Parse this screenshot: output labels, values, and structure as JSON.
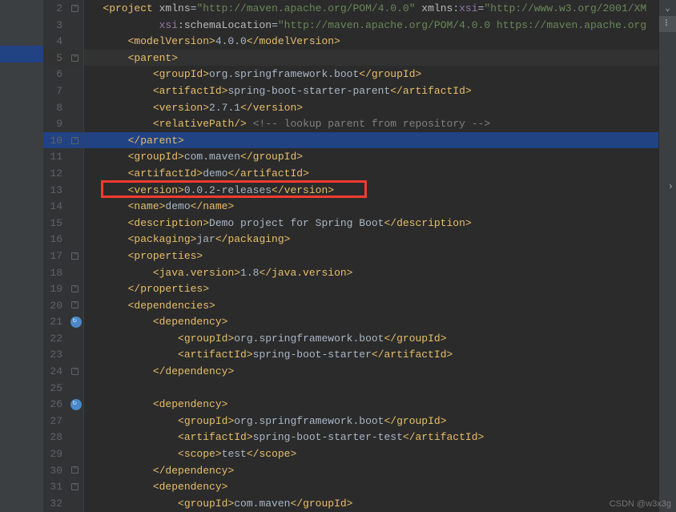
{
  "lineNumbers": [
    "2",
    "3",
    "4",
    "5",
    "6",
    "7",
    "8",
    "9",
    "10",
    "11",
    "12",
    "13",
    "14",
    "15",
    "16",
    "17",
    "18",
    "19",
    "20",
    "21",
    "22",
    "23",
    "24",
    "25",
    "26",
    "27",
    "28",
    "29",
    "30",
    "31",
    "32"
  ],
  "code": {
    "l2": {
      "indent": "   ",
      "parts": [
        {
          "t": "<project ",
          "c": "tag"
        },
        {
          "t": "xmlns",
          "c": "attr-name"
        },
        {
          "t": "=",
          "c": "text-val"
        },
        {
          "t": "\"http://maven.apache.org/POM/4.0.0\"",
          "c": "attr-val"
        },
        {
          "t": " xmlns",
          "c": "attr-name"
        },
        {
          "t": ":",
          "c": "text-val"
        },
        {
          "t": "xsi",
          "c": "ns"
        },
        {
          "t": "=",
          "c": "text-val"
        },
        {
          "t": "\"http://www.w3.org/2001/XM",
          "c": "attr-val"
        }
      ]
    },
    "l3": {
      "indent": "            ",
      "parts": [
        {
          "t": "xsi",
          "c": "ns"
        },
        {
          "t": ":schemaLocation",
          "c": "attr-name"
        },
        {
          "t": "=",
          "c": "text-val"
        },
        {
          "t": "\"http://maven.apache.org/POM/4.0.0 https://maven.apache.org",
          "c": "attr-val"
        }
      ]
    },
    "l4": {
      "indent": "       ",
      "parts": [
        {
          "t": "<modelVersion>",
          "c": "tag"
        },
        {
          "t": "4.0.0",
          "c": "text-val"
        },
        {
          "t": "</modelVersion>",
          "c": "tag"
        }
      ]
    },
    "l5": {
      "indent": "       ",
      "parts": [
        {
          "t": "<parent>",
          "c": "tag"
        }
      ]
    },
    "l6": {
      "indent": "           ",
      "parts": [
        {
          "t": "<groupId>",
          "c": "tag"
        },
        {
          "t": "org.springframework.boot",
          "c": "text-val"
        },
        {
          "t": "</groupId>",
          "c": "tag"
        }
      ]
    },
    "l7": {
      "indent": "           ",
      "parts": [
        {
          "t": "<artifactId>",
          "c": "tag"
        },
        {
          "t": "spring-boot-starter-parent",
          "c": "text-val"
        },
        {
          "t": "</artifactId>",
          "c": "tag"
        }
      ]
    },
    "l8": {
      "indent": "           ",
      "parts": [
        {
          "t": "<version>",
          "c": "tag"
        },
        {
          "t": "2.7.1",
          "c": "text-val"
        },
        {
          "t": "</version>",
          "c": "tag"
        }
      ]
    },
    "l9": {
      "indent": "           ",
      "parts": [
        {
          "t": "<relativePath/>",
          "c": "tag"
        },
        {
          "t": " ",
          "c": "text-val"
        },
        {
          "t": "<!-- lookup parent from repository -->",
          "c": "comment"
        }
      ]
    },
    "l10": {
      "indent": "       ",
      "parts": [
        {
          "t": "</parent>",
          "c": "tag"
        }
      ]
    },
    "l11": {
      "indent": "       ",
      "parts": [
        {
          "t": "<groupId>",
          "c": "tag"
        },
        {
          "t": "com.maven",
          "c": "text-val"
        },
        {
          "t": "</groupId>",
          "c": "tag"
        }
      ]
    },
    "l12": {
      "indent": "       ",
      "parts": [
        {
          "t": "<artifactId>",
          "c": "tag"
        },
        {
          "t": "demo",
          "c": "text-val"
        },
        {
          "t": "</artifactId>",
          "c": "tag"
        }
      ]
    },
    "l13": {
      "indent": "       ",
      "parts": [
        {
          "t": "<version>",
          "c": "tag"
        },
        {
          "t": "0.0.2-releases",
          "c": "text-val"
        },
        {
          "t": "</version>",
          "c": "tag"
        }
      ]
    },
    "l14": {
      "indent": "       ",
      "parts": [
        {
          "t": "<name>",
          "c": "tag"
        },
        {
          "t": "demo",
          "c": "text-val"
        },
        {
          "t": "</name>",
          "c": "tag"
        }
      ]
    },
    "l15": {
      "indent": "       ",
      "parts": [
        {
          "t": "<description>",
          "c": "tag"
        },
        {
          "t": "Demo project for Spring Boot",
          "c": "text-val"
        },
        {
          "t": "</description>",
          "c": "tag"
        }
      ]
    },
    "l16": {
      "indent": "       ",
      "parts": [
        {
          "t": "<packaging>",
          "c": "tag"
        },
        {
          "t": "jar",
          "c": "text-val"
        },
        {
          "t": "</packaging>",
          "c": "tag"
        }
      ]
    },
    "l17": {
      "indent": "       ",
      "parts": [
        {
          "t": "<properties>",
          "c": "tag"
        }
      ]
    },
    "l18": {
      "indent": "           ",
      "parts": [
        {
          "t": "<java.version>",
          "c": "tag"
        },
        {
          "t": "1.8",
          "c": "text-val"
        },
        {
          "t": "</java.version>",
          "c": "tag"
        }
      ]
    },
    "l19": {
      "indent": "       ",
      "parts": [
        {
          "t": "</properties>",
          "c": "tag"
        }
      ]
    },
    "l20": {
      "indent": "       ",
      "parts": [
        {
          "t": "<dependencies>",
          "c": "tag"
        }
      ]
    },
    "l21": {
      "indent": "           ",
      "parts": [
        {
          "t": "<dependency>",
          "c": "tag"
        }
      ]
    },
    "l22": {
      "indent": "               ",
      "parts": [
        {
          "t": "<groupId>",
          "c": "tag"
        },
        {
          "t": "org.springframework.boot",
          "c": "text-val"
        },
        {
          "t": "</groupId>",
          "c": "tag"
        }
      ]
    },
    "l23": {
      "indent": "               ",
      "parts": [
        {
          "t": "<artifactId>",
          "c": "tag"
        },
        {
          "t": "spring-boot-starter",
          "c": "text-val"
        },
        {
          "t": "</artifactId>",
          "c": "tag"
        }
      ]
    },
    "l24": {
      "indent": "           ",
      "parts": [
        {
          "t": "</dependency>",
          "c": "tag"
        }
      ]
    },
    "l25": {
      "indent": "",
      "parts": []
    },
    "l26": {
      "indent": "           ",
      "parts": [
        {
          "t": "<dependency>",
          "c": "tag"
        }
      ]
    },
    "l27": {
      "indent": "               ",
      "parts": [
        {
          "t": "<groupId>",
          "c": "tag"
        },
        {
          "t": "org.springframework.boot",
          "c": "text-val"
        },
        {
          "t": "</groupId>",
          "c": "tag"
        }
      ]
    },
    "l28": {
      "indent": "               ",
      "parts": [
        {
          "t": "<artifactId>",
          "c": "tag"
        },
        {
          "t": "spring-boot-starter-test",
          "c": "text-val"
        },
        {
          "t": "</artifactId>",
          "c": "tag"
        }
      ]
    },
    "l29": {
      "indent": "               ",
      "parts": [
        {
          "t": "<scope>",
          "c": "tag"
        },
        {
          "t": "test",
          "c": "text-val"
        },
        {
          "t": "</scope>",
          "c": "tag"
        }
      ]
    },
    "l30": {
      "indent": "           ",
      "parts": [
        {
          "t": "</dependency>",
          "c": "tag"
        }
      ]
    },
    "l31": {
      "indent": "           ",
      "parts": [
        {
          "t": "<dependency>",
          "c": "tag"
        }
      ]
    },
    "l32": {
      "indent": "               ",
      "parts": [
        {
          "t": "<groupId>",
          "c": "tag"
        },
        {
          "t": "com.maven",
          "c": "text-val"
        },
        {
          "t": "</groupId>",
          "c": "tag"
        }
      ]
    }
  },
  "selectedLine": "10",
  "activeLine": "5",
  "gutterIcons": {
    "21": true,
    "26": true
  },
  "foldMarks": {
    "2": true,
    "5": true,
    "10": "close",
    "17": true,
    "19": "close",
    "20": true,
    "21": true,
    "24": "close",
    "26": true,
    "30": "close",
    "31": true
  },
  "watermark": "CSDN @w3x3g",
  "rightBar": {
    "chevronDown": "⌄",
    "more": "⠇"
  }
}
